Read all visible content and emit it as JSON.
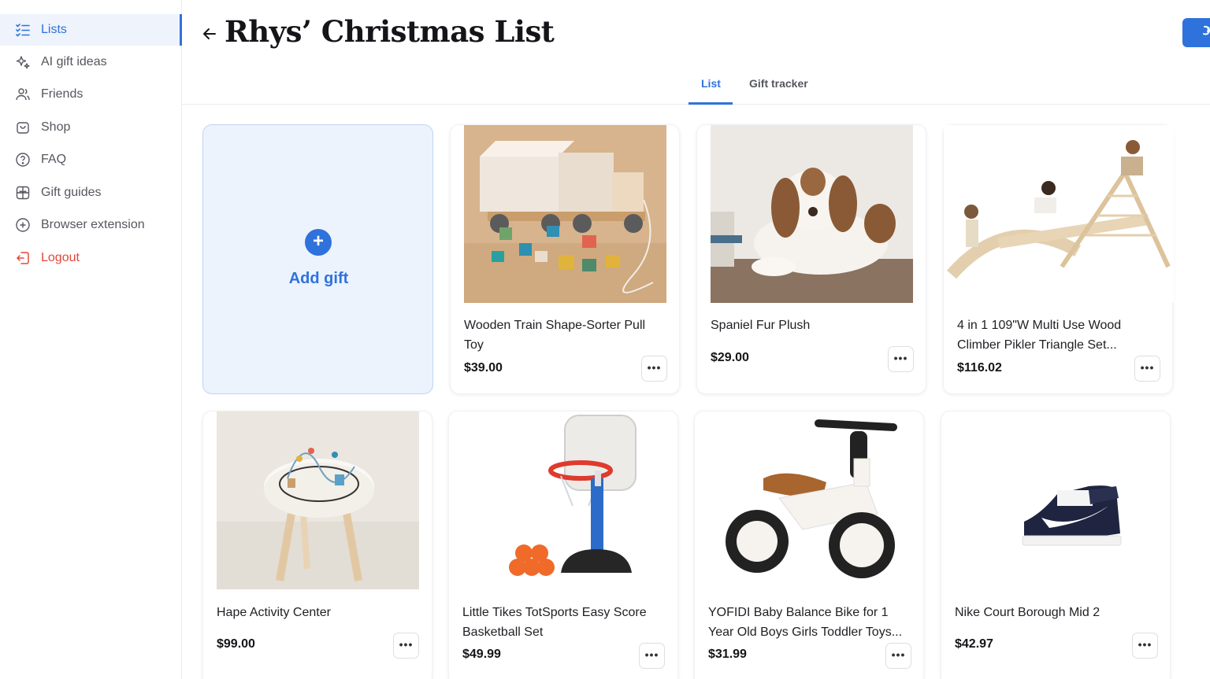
{
  "sidebar": {
    "items": [
      {
        "label": "Lists",
        "icon": "list-icon"
      },
      {
        "label": "AI gift ideas",
        "icon": "sparkles-icon"
      },
      {
        "label": "Friends",
        "icon": "friends-icon"
      },
      {
        "label": "Shop",
        "icon": "shopping-bag-icon"
      },
      {
        "label": "FAQ",
        "icon": "help-circle-icon"
      },
      {
        "label": "Gift guides",
        "icon": "gift-guide-icon"
      },
      {
        "label": "Browser extension",
        "icon": "plus-circle-icon"
      },
      {
        "label": "Logout",
        "icon": "logout-icon"
      }
    ]
  },
  "header": {
    "title": "Rhys’ Christmas List",
    "back_icon": "back-arrow-icon",
    "share_icon": "share-icon"
  },
  "tabs": [
    {
      "label": "List",
      "active": true
    },
    {
      "label": "Gift tracker",
      "active": false
    }
  ],
  "add_card": {
    "label": "Add gift",
    "icon": "plus-icon"
  },
  "gifts": [
    {
      "name": "Wooden Train Shape-Sorter Pull Toy",
      "price": "$39.00"
    },
    {
      "name": "Spaniel Fur Plush",
      "price": "$29.00"
    },
    {
      "name": "4 in 1 109\"W Multi Use Wood Climber Pikler Triangle Set...",
      "price": "$116.02"
    },
    {
      "name": "Hape Activity Center",
      "price": "$99.00"
    },
    {
      "name": "Little Tikes TotSports Easy Score Basketball Set",
      "price": "$49.99"
    },
    {
      "name": "YOFIDI Baby Balance Bike for 1 Year Old Boys Girls Toddler Toys...",
      "price": "$31.99"
    },
    {
      "name": "Nike Court Borough Mid 2",
      "price": "$42.97"
    }
  ],
  "more_label": "•••",
  "colors": {
    "accent": "#2f72dc",
    "logout": "#e2463a",
    "add_card_bg": "#ecf3fd"
  }
}
